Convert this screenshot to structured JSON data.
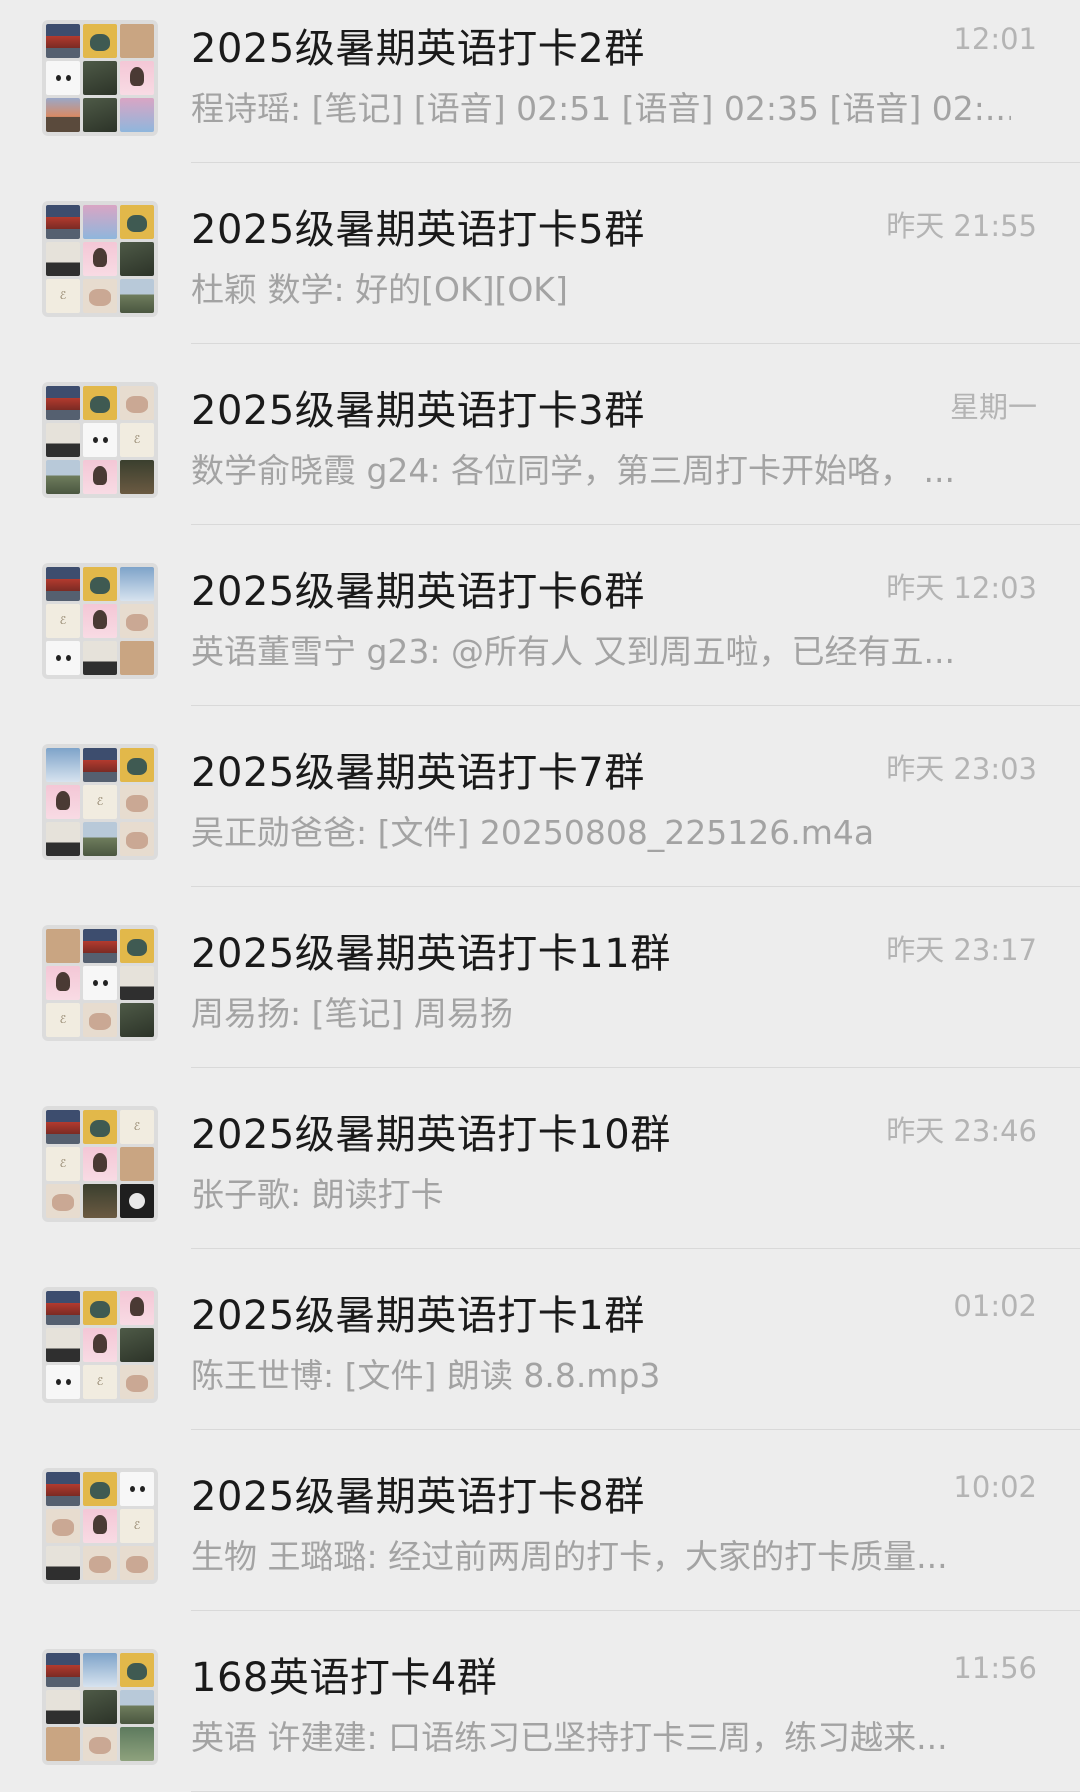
{
  "chats": [
    {
      "name": "2025级暑期英语打卡2群",
      "time": "12:01",
      "preview": "程诗瑶: [笔记] [语音] 02:51 [语音] 02:35 [语音] 02:...",
      "avatar": [
        "c-red",
        "c-pig",
        "c-cat",
        "c-white",
        "c-dark",
        "c-girl",
        "c-sunset",
        "c-dark",
        "c-pink"
      ]
    },
    {
      "name": "2025级暑期英语打卡5群",
      "time": "昨天 21:55",
      "preview": "杜颖  数学: 好的[OK][OK]",
      "avatar": [
        "c-red",
        "c-pink",
        "c-pig",
        "c-man",
        "c-girl",
        "c-dark",
        "c-cream",
        "c-kids",
        "c-land"
      ]
    },
    {
      "name": "2025级暑期英语打卡3群",
      "time": "星期一",
      "preview": "数学俞晓霞 g24: 各位同学，第三周打卡开始咯， ...",
      "avatar": [
        "c-red",
        "c-pig",
        "c-kids",
        "c-man",
        "c-white",
        "c-cream",
        "c-land",
        "c-girl",
        "c-night"
      ]
    },
    {
      "name": "2025级暑期英语打卡6群",
      "time": "昨天 12:03",
      "preview": "英语董雪宁 g23: @所有人 又到周五啦，已经有五...",
      "avatar": [
        "c-red",
        "c-pig",
        "c-blue",
        "c-cream",
        "c-girl",
        "c-kids",
        "c-white",
        "c-man",
        "c-cat"
      ]
    },
    {
      "name": "2025级暑期英语打卡7群",
      "time": "昨天 23:03",
      "preview": "吴正勋爸爸: [文件] 20250808_225126.m4a",
      "avatar": [
        "c-blue",
        "c-red",
        "c-pig",
        "c-girl",
        "c-cream",
        "c-kids",
        "c-man",
        "c-land",
        "c-kids"
      ]
    },
    {
      "name": "2025级暑期英语打卡11群",
      "time": "昨天 23:17",
      "preview": "周易扬: [笔记] 周易扬",
      "avatar": [
        "c-cat",
        "c-red",
        "c-pig",
        "c-girl",
        "c-white",
        "c-man",
        "c-cream",
        "c-kids",
        "c-dark"
      ]
    },
    {
      "name": "2025级暑期英语打卡10群",
      "time": "昨天 23:46",
      "preview": "张子歌: 朗读打卡",
      "avatar": [
        "c-red",
        "c-pig",
        "c-cream",
        "c-cream",
        "c-girl",
        "c-cat",
        "c-kids",
        "c-night",
        "c-bw"
      ]
    },
    {
      "name": "2025级暑期英语打卡1群",
      "time": "01:02",
      "preview": "陈王世博: [文件] 朗读 8.8.mp3",
      "avatar": [
        "c-red",
        "c-pig",
        "c-girl",
        "c-man",
        "c-girl",
        "c-dark",
        "c-white",
        "c-cream",
        "c-kids"
      ]
    },
    {
      "name": "2025级暑期英语打卡8群",
      "time": "10:02",
      "preview": "生物 王璐璐: 经过前两周的打卡，大家的打卡质量...",
      "avatar": [
        "c-red",
        "c-pig",
        "c-white",
        "c-kids",
        "c-girl",
        "c-cream",
        "c-man",
        "c-kids",
        "c-kids"
      ]
    },
    {
      "name": "168英语打卡4群",
      "time": "11:56",
      "preview": "英语 许建建: 口语练习已坚持打卡三周，练习越来...",
      "avatar": [
        "c-red",
        "c-blue",
        "c-pig",
        "c-man",
        "c-dark",
        "c-land",
        "c-cat",
        "c-kids",
        "c-green"
      ]
    }
  ]
}
